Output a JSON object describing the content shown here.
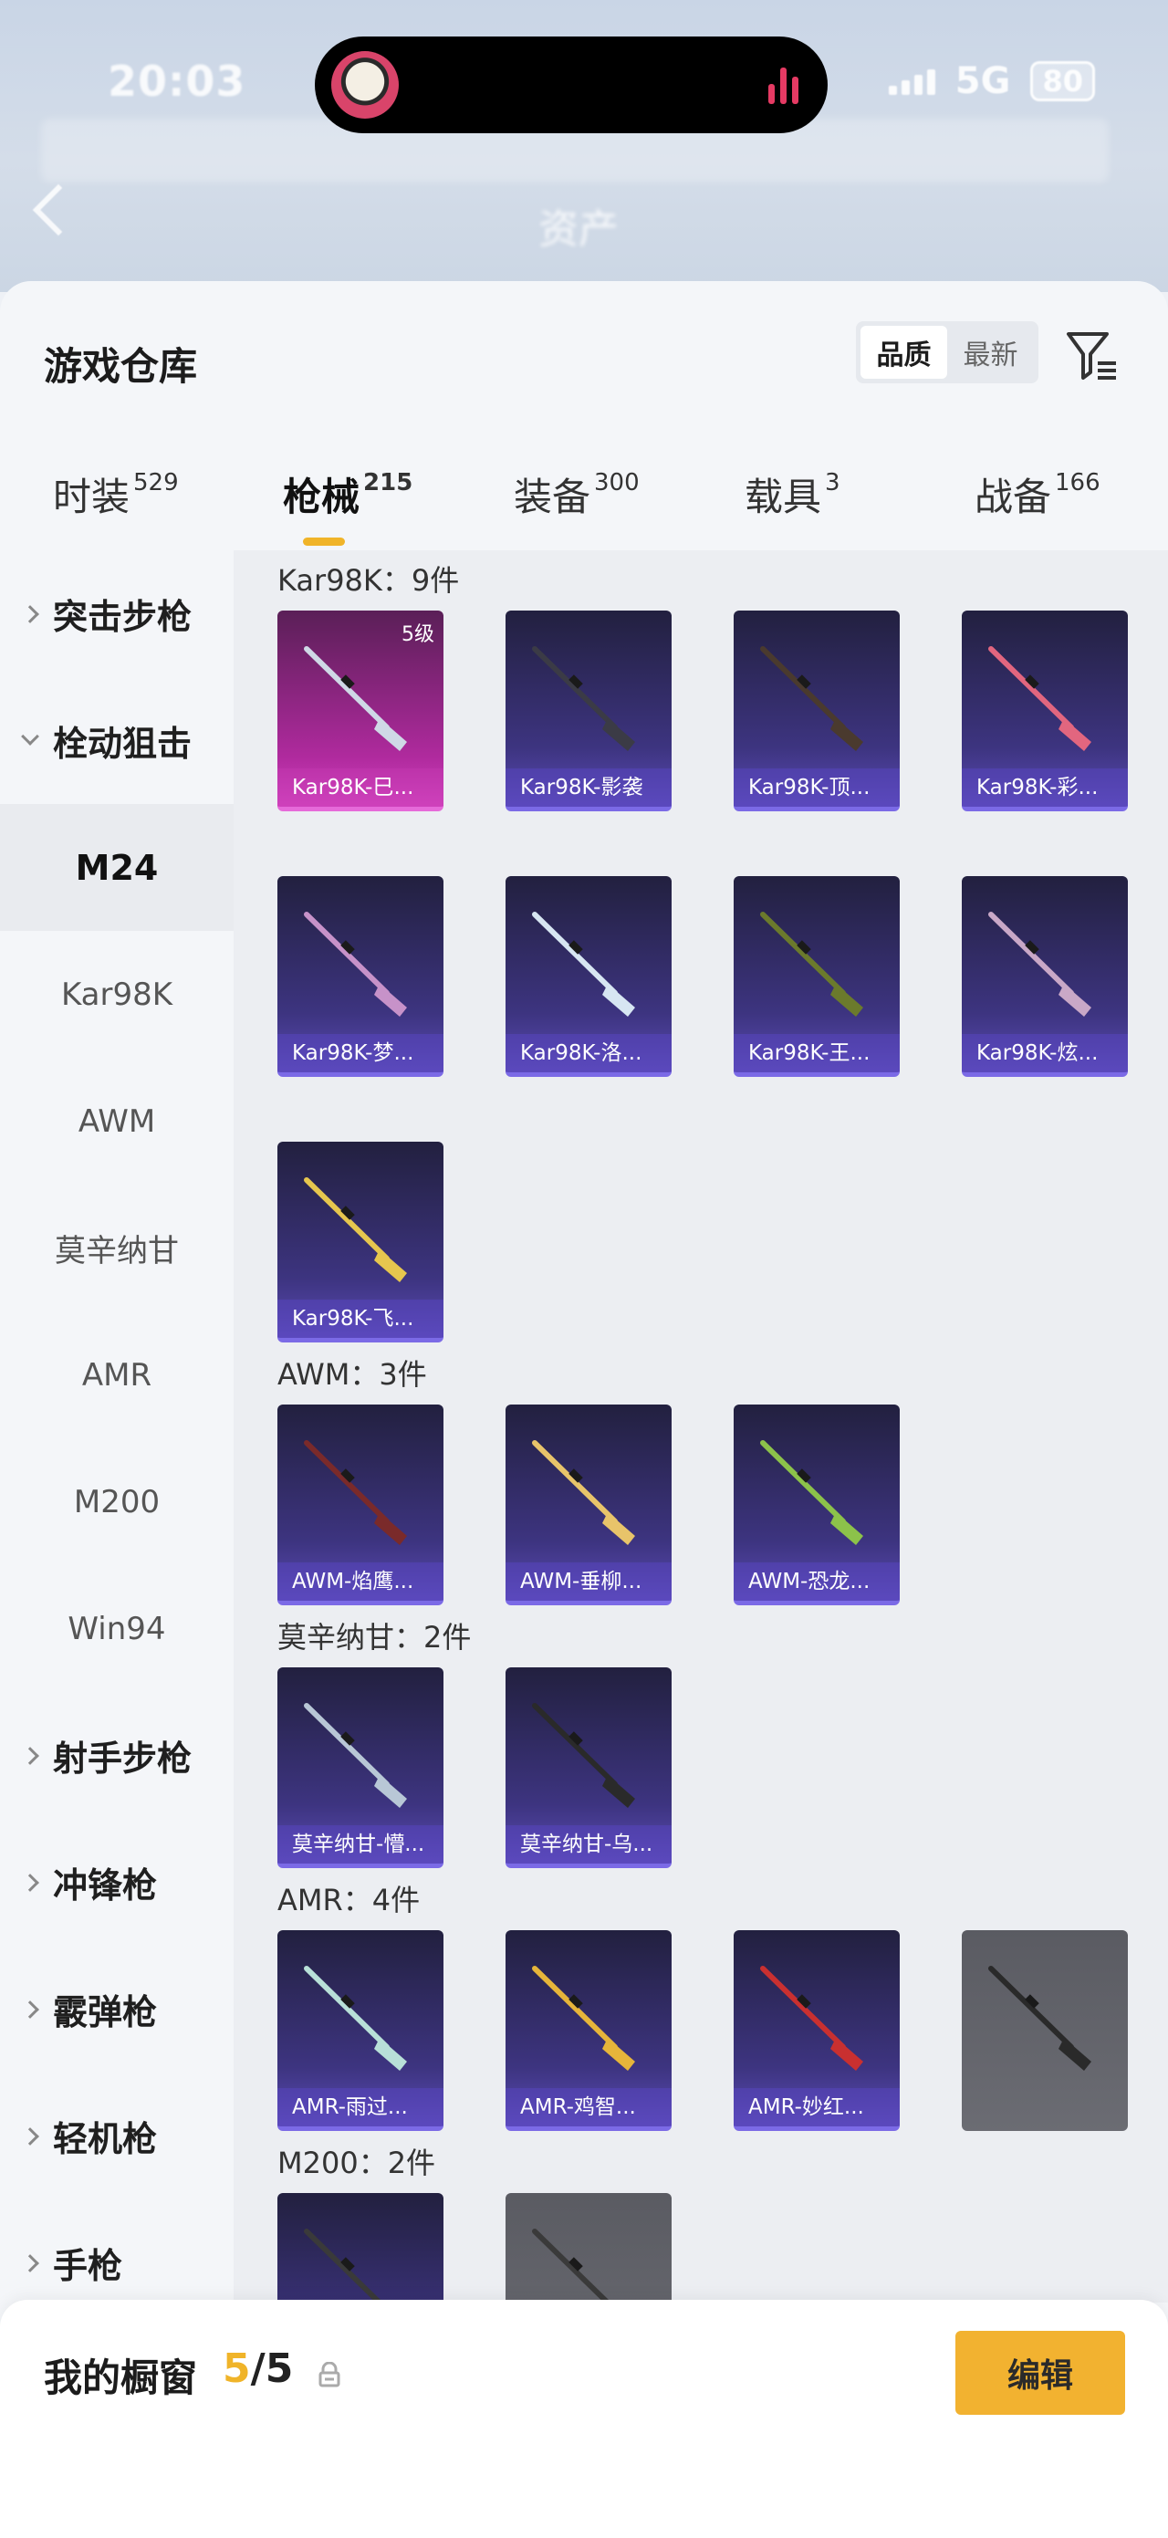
{
  "status_bar": {
    "time": "20:03",
    "network": "5G",
    "battery": "80"
  },
  "backdrop": {
    "title": "资产"
  },
  "header": {
    "title": "游戏仓库",
    "sort_options": [
      "品质",
      "最新"
    ],
    "active_sort": "品质",
    "filter_icon": "filter-icon"
  },
  "tabs": [
    {
      "label": "时装",
      "count": "529"
    },
    {
      "label": "枪械",
      "count": "215",
      "active": true
    },
    {
      "label": "装备",
      "count": "300"
    },
    {
      "label": "载具",
      "count": "3"
    },
    {
      "label": "战备",
      "count": "166"
    }
  ],
  "sidebar": {
    "items": [
      {
        "label": "突击步枪",
        "type": "group",
        "expanded": false
      },
      {
        "label": "栓动狙击",
        "type": "group",
        "expanded": true
      },
      {
        "label": "M24",
        "type": "sub",
        "active": true
      },
      {
        "label": "Kar98K",
        "type": "sub"
      },
      {
        "label": "AWM",
        "type": "sub"
      },
      {
        "label": "莫辛纳甘",
        "type": "sub"
      },
      {
        "label": "AMR",
        "type": "sub"
      },
      {
        "label": "M200",
        "type": "sub"
      },
      {
        "label": "Win94",
        "type": "sub"
      },
      {
        "label": "射手步枪",
        "type": "group",
        "expanded": false
      },
      {
        "label": "冲锋枪",
        "type": "group",
        "expanded": false
      },
      {
        "label": "霰弹枪",
        "type": "group",
        "expanded": false
      },
      {
        "label": "轻机枪",
        "type": "group",
        "expanded": false
      },
      {
        "label": "手枪",
        "type": "group",
        "expanded": false
      }
    ]
  },
  "sections": [
    {
      "label": "Kar98K：9件",
      "items": [
        {
          "name": "Kar98K-巳...",
          "tier": "gold",
          "level": "5级"
        },
        {
          "name": "Kar98K-影袭",
          "tier": "purple"
        },
        {
          "name": "Kar98K-顶...",
          "tier": "purple"
        },
        {
          "name": "Kar98K-彩...",
          "tier": "purple"
        },
        {
          "name": "Kar98K-梦...",
          "tier": "purple"
        },
        {
          "name": "Kar98K-洛...",
          "tier": "purple"
        },
        {
          "name": "Kar98K-王...",
          "tier": "purple"
        },
        {
          "name": "Kar98K-炫...",
          "tier": "purple"
        },
        {
          "name": "Kar98K-飞...",
          "tier": "purple"
        }
      ]
    },
    {
      "label": "AWM：3件",
      "items": [
        {
          "name": "AWM-焰鹰...",
          "tier": "purple"
        },
        {
          "name": "AWM-垂柳...",
          "tier": "purple"
        },
        {
          "name": "AWM-恐龙...",
          "tier": "purple"
        }
      ]
    },
    {
      "label": "莫辛纳甘：2件",
      "items": [
        {
          "name": "莫辛纳甘-懵...",
          "tier": "purple"
        },
        {
          "name": "莫辛纳甘-乌...",
          "tier": "purple"
        }
      ]
    },
    {
      "label": "AMR：4件",
      "items": [
        {
          "name": "AMR-雨过...",
          "tier": "purple"
        },
        {
          "name": "AMR-鸡智...",
          "tier": "purple"
        },
        {
          "name": "AMR-妙红...",
          "tier": "purple"
        },
        {
          "name": "",
          "tier": "gray"
        }
      ]
    },
    {
      "label": "M200：2件",
      "items": [
        {
          "name": "",
          "tier": "purple"
        },
        {
          "name": "",
          "tier": "gray"
        }
      ]
    }
  ],
  "showcase": {
    "label": "我的橱窗",
    "current": "5",
    "separator": "/",
    "total": "5",
    "edit_label": "编辑"
  },
  "colors": {
    "accent": "#f0b429",
    "purple_card": "#3d3480",
    "gold_card": "#b02a9e"
  }
}
